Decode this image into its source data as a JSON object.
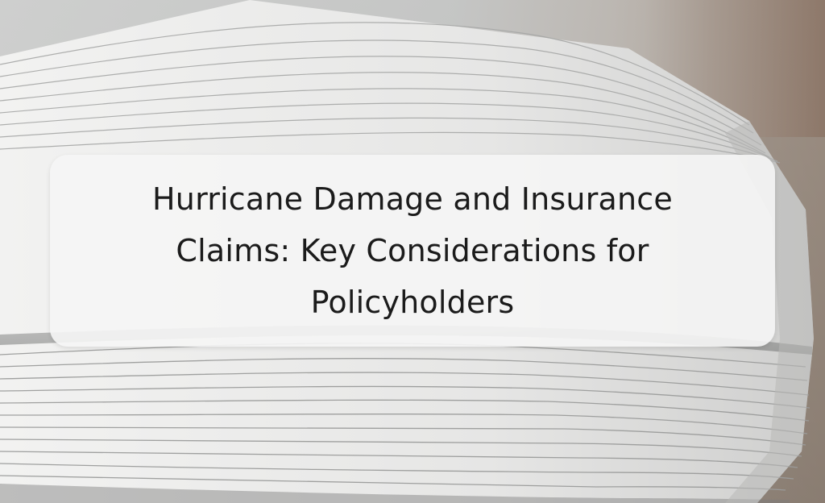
{
  "image": {
    "subject": "paper-stack-photo",
    "title_card": {
      "title": "Hurricane Damage and Insurance Claims: Key Considerations for Policyholders"
    },
    "colors": {
      "card_background": "#f5f5f5",
      "title_text": "#1b1b1b",
      "paper": "#e9e9e8",
      "paper_shadow": "#9e9f9e",
      "background_warm": "#8b7465"
    }
  }
}
